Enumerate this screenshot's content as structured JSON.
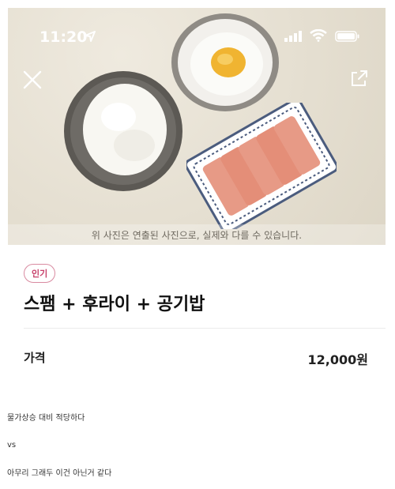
{
  "status_bar": {
    "time": "11:20"
  },
  "hero": {
    "disclaimer": "위 사진은 연출된 사진으로, 실제와 다를 수 있습니다."
  },
  "product": {
    "badge": "인기",
    "title": "스팸 + 후라이 + 공기밥",
    "price_label": "가격",
    "price_value": "12,000원"
  },
  "comments": [
    "물가상승 대비 적당하다",
    "vs",
    "아무리 그래두 이건 아닌거 같다"
  ],
  "icons": {
    "location": "location-arrow-icon",
    "signal": "cellular-signal-icon",
    "wifi": "wifi-icon",
    "battery": "battery-icon",
    "close": "close-icon",
    "share": "share-icon"
  },
  "colors": {
    "badge_border": "#d98aa0",
    "badge_text": "#c7406a",
    "hero_bg": "#e7e1d3"
  }
}
